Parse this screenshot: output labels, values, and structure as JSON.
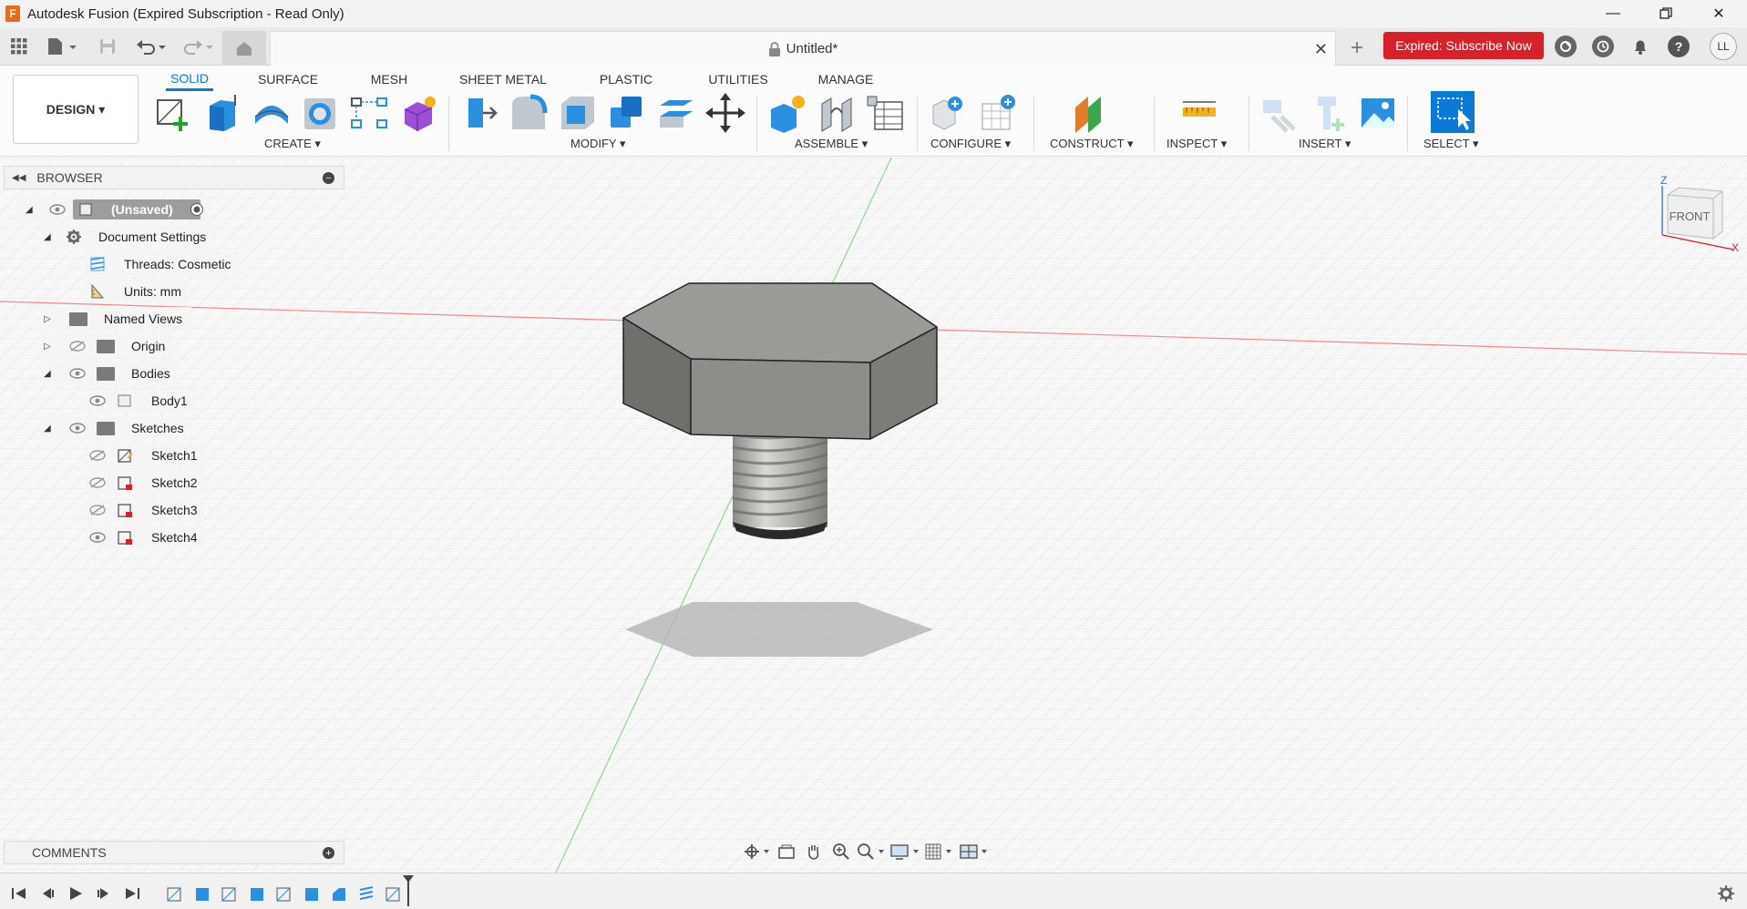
{
  "window": {
    "title": "Autodesk Fusion (Expired Subscription - Read Only)",
    "logo_letter": "F"
  },
  "tabs": {
    "document_title": "Untitled*",
    "subscribe_label": "Expired: Subscribe Now",
    "user_initials": "LL",
    "help_label": "?"
  },
  "ribbon": {
    "workspace": "DESIGN ▾",
    "tabs": [
      "SOLID",
      "SURFACE",
      "MESH",
      "SHEET METAL",
      "PLASTIC",
      "UTILITIES",
      "MANAGE"
    ],
    "groups": [
      "CREATE ▾",
      "MODIFY ▾",
      "ASSEMBLE ▾",
      "CONFIGURE ▾",
      "CONSTRUCT ▾",
      "INSPECT ▾",
      "INSERT ▾",
      "SELECT ▾"
    ]
  },
  "browser": {
    "title": "BROWSER",
    "root": "(Unsaved)",
    "document_settings": "Document Settings",
    "threads": "Threads: Cosmetic",
    "units": "Units: mm",
    "named_views": "Named Views",
    "origin": "Origin",
    "bodies": "Bodies",
    "body1": "Body1",
    "sketches": "Sketches",
    "sketch_items": [
      "Sketch1",
      "Sketch2",
      "Sketch3",
      "Sketch4"
    ]
  },
  "comments": {
    "title": "COMMENTS"
  },
  "viewcube": {
    "face": "FRONT",
    "axis_z": "Z",
    "axis_x": "X"
  },
  "colors": {
    "accent": "#0a79d8",
    "subscribe": "#d6202a",
    "hex_top": "#9a9b96",
    "hex_side": "#7c7d78"
  }
}
